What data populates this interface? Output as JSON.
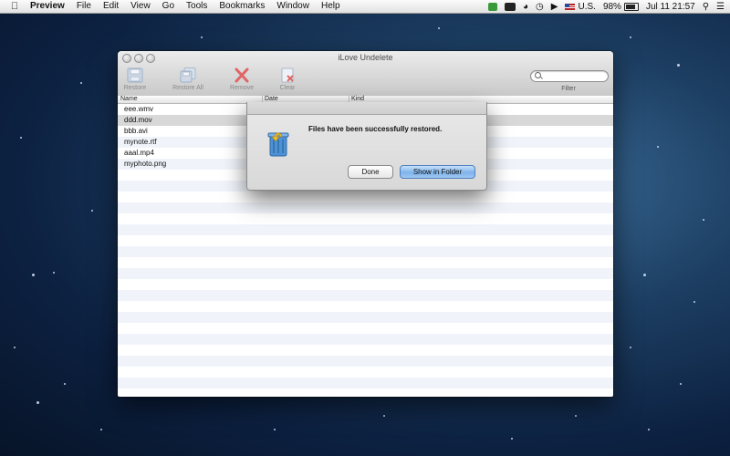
{
  "menubar": {
    "apple_icon": "apple-icon",
    "items": [
      "Preview",
      "File",
      "Edit",
      "View",
      "Go",
      "Tools",
      "Bookmarks",
      "Window",
      "Help"
    ],
    "status": {
      "input_source": "U.S.",
      "battery_percent": "98%",
      "clock": "Jul 11  21:57"
    }
  },
  "window": {
    "title": "iLove Undelete",
    "toolbar": {
      "restore": "Restore",
      "restore_all": "Restore All",
      "remove": "Remove",
      "clear": "Clear",
      "filter": "Filter",
      "search_placeholder": ""
    },
    "table": {
      "columns": [
        "Name",
        "Date",
        "Kind"
      ],
      "rows": [
        "eee.wmv",
        "ddd.mov",
        "bbb.avi",
        "mynote.rtf",
        "aaal.mp4",
        "myphoto.png"
      ],
      "selected_index": 1
    }
  },
  "dialog": {
    "message": "Files have been successfully restored.",
    "done_label": "Done",
    "show_label": "Show in Folder"
  },
  "colors": {
    "selection": "#d8d8d8",
    "row_stripe": "#f0f4fa",
    "primary_button": "#7eb3ea"
  }
}
